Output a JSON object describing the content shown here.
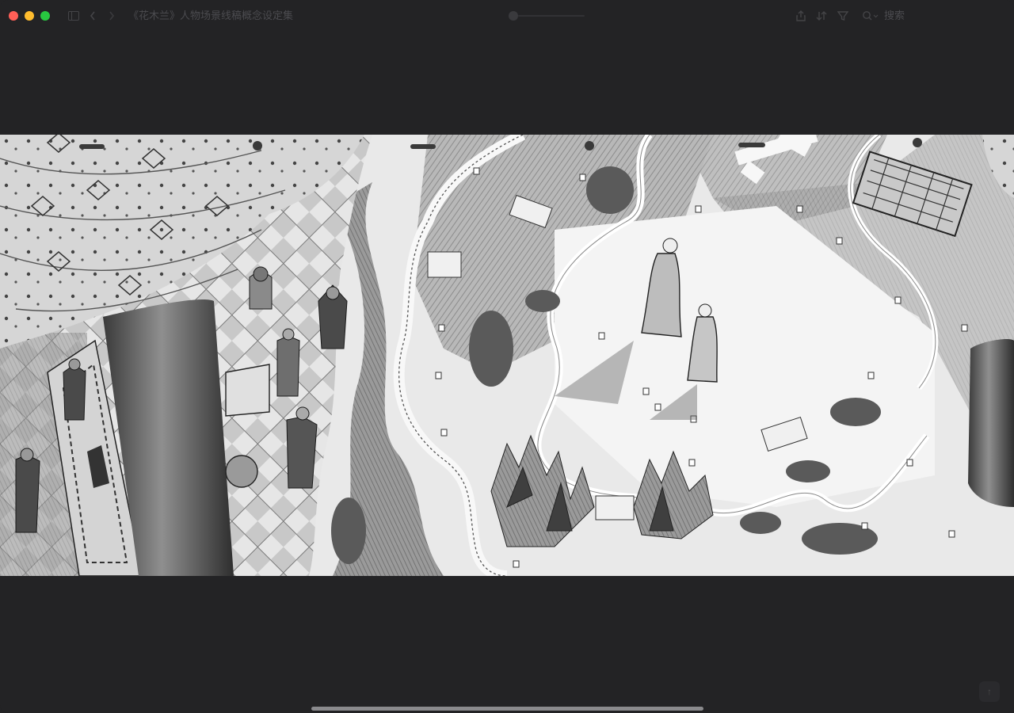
{
  "window": {
    "title": "《花木兰》人物场景线稿概念设定集",
    "search_label": "搜索"
  },
  "toolbar": {
    "back_icon": "chevron-left-icon",
    "forward_icon": "chevron-right-icon",
    "sidebar_icon": "sidebar-icon",
    "share_icon": "share-icon",
    "sort_icon": "sort-icon",
    "filter_icon": "filter-icon",
    "search_icon": "search-icon"
  },
  "viewer": {
    "image_alt": "黑白线稿：宫殿大厅与山川地图场景"
  },
  "colors": {
    "background": "#232325",
    "close": "#ff5f57",
    "minimize": "#febc2e",
    "maximize": "#28c840"
  }
}
